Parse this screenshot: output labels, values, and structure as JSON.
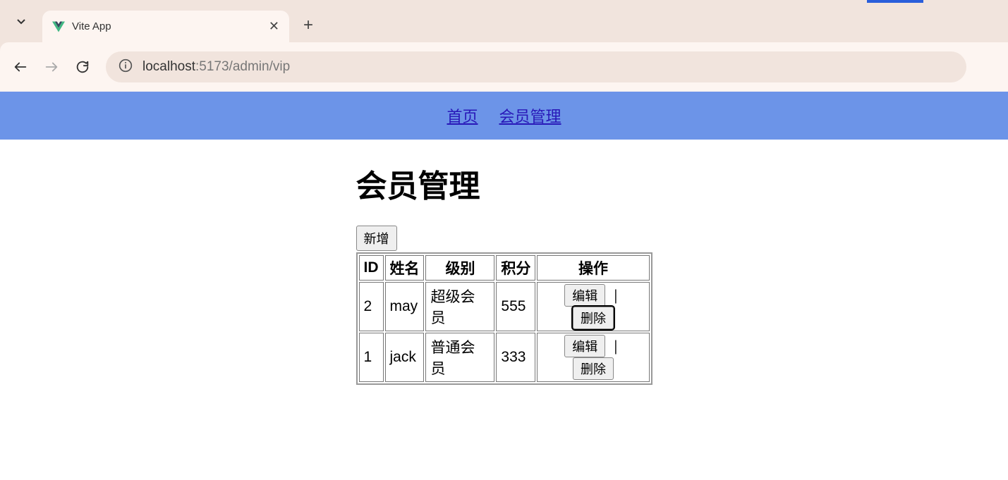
{
  "browser": {
    "tab_title": "Vite App",
    "url_origin": "localhost",
    "url_port_path": ":5173/admin/vip"
  },
  "nav": {
    "home": "首页",
    "vip": "会员管理"
  },
  "page": {
    "title": "会员管理",
    "add_button": "新增",
    "columns": {
      "id": "ID",
      "name": "姓名",
      "level": "级别",
      "points": "积分",
      "ops": "操作"
    },
    "ops": {
      "edit": "编辑",
      "delete": "删除",
      "sep": "|"
    },
    "rows": [
      {
        "id": "2",
        "name": "may",
        "level": "超级会员",
        "points": "555"
      },
      {
        "id": "1",
        "name": "jack",
        "level": "普通会员",
        "points": "333"
      }
    ]
  }
}
